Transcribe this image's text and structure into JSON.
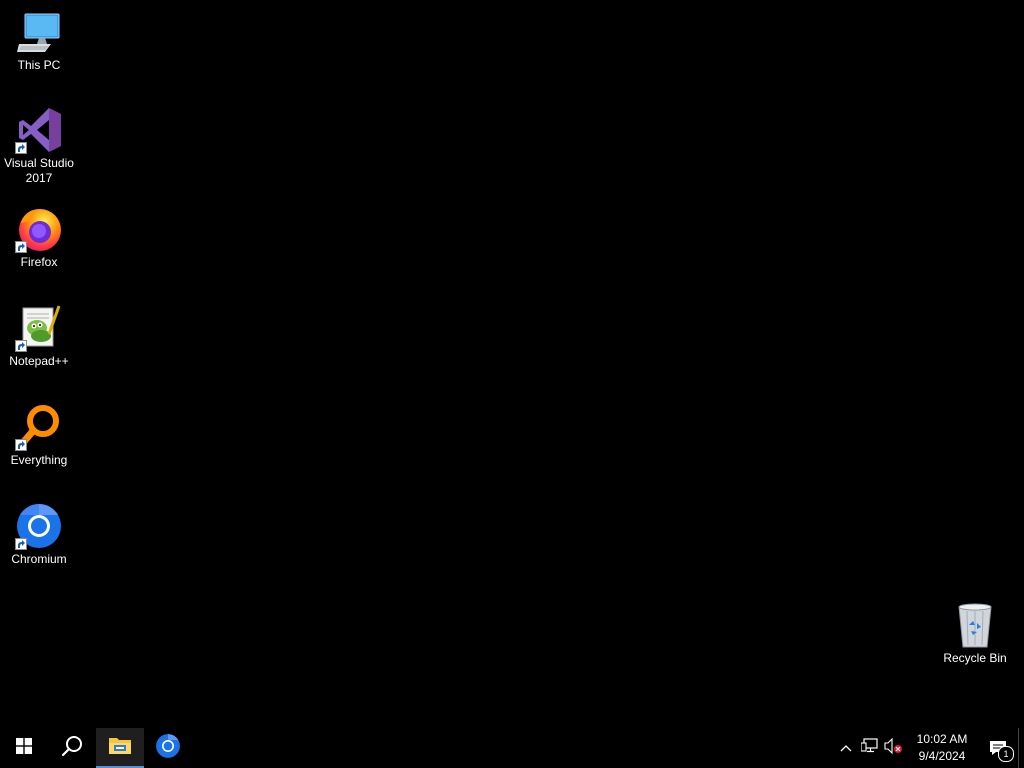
{
  "desktop": {
    "background": "#000000",
    "icons": [
      {
        "label": "This PC",
        "icon": "this-pc-icon",
        "shortcut": false
      },
      {
        "label": "Visual Studio\n2017",
        "icon": "visual-studio-icon",
        "shortcut": true
      },
      {
        "label": "Firefox",
        "icon": "firefox-icon",
        "shortcut": true
      },
      {
        "label": "Notepad++",
        "icon": "notepad-plus-plus-icon",
        "shortcut": true
      },
      {
        "label": "Everything",
        "icon": "everything-search-icon",
        "shortcut": true
      },
      {
        "label": "Chromium",
        "icon": "chromium-icon",
        "shortcut": true
      }
    ],
    "recycle_bin": {
      "label": "Recycle Bin",
      "icon": "recycle-bin-icon"
    }
  },
  "taskbar": {
    "start": {
      "icon": "windows-start-icon"
    },
    "search": {
      "icon": "search-icon"
    },
    "pinned": [
      {
        "name": "File Explorer",
        "icon": "file-explorer-icon",
        "active": true
      },
      {
        "name": "Chromium",
        "icon": "chromium-icon",
        "active": false
      }
    ],
    "tray": {
      "icons": [
        "chevron-up-icon",
        "network-icon",
        "volume-muted-icon"
      ],
      "time": "10:02 AM",
      "date": "9/4/2024",
      "notification_count": "1"
    }
  }
}
